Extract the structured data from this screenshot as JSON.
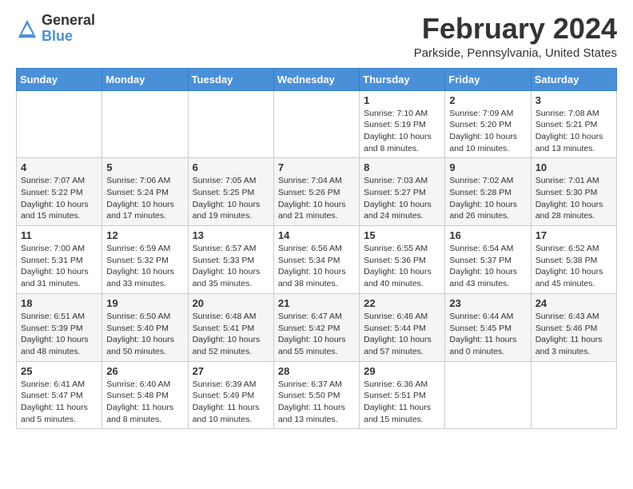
{
  "header": {
    "logo_general": "General",
    "logo_blue": "Blue",
    "month_year": "February 2024",
    "location": "Parkside, Pennsylvania, United States"
  },
  "weekdays": [
    "Sunday",
    "Monday",
    "Tuesday",
    "Wednesday",
    "Thursday",
    "Friday",
    "Saturday"
  ],
  "weeks": [
    [
      {
        "day": "",
        "info": ""
      },
      {
        "day": "",
        "info": ""
      },
      {
        "day": "",
        "info": ""
      },
      {
        "day": "",
        "info": ""
      },
      {
        "day": "1",
        "info": "Sunrise: 7:10 AM\nSunset: 5:19 PM\nDaylight: 10 hours\nand 8 minutes."
      },
      {
        "day": "2",
        "info": "Sunrise: 7:09 AM\nSunset: 5:20 PM\nDaylight: 10 hours\nand 10 minutes."
      },
      {
        "day": "3",
        "info": "Sunrise: 7:08 AM\nSunset: 5:21 PM\nDaylight: 10 hours\nand 13 minutes."
      }
    ],
    [
      {
        "day": "4",
        "info": "Sunrise: 7:07 AM\nSunset: 5:22 PM\nDaylight: 10 hours\nand 15 minutes."
      },
      {
        "day": "5",
        "info": "Sunrise: 7:06 AM\nSunset: 5:24 PM\nDaylight: 10 hours\nand 17 minutes."
      },
      {
        "day": "6",
        "info": "Sunrise: 7:05 AM\nSunset: 5:25 PM\nDaylight: 10 hours\nand 19 minutes."
      },
      {
        "day": "7",
        "info": "Sunrise: 7:04 AM\nSunset: 5:26 PM\nDaylight: 10 hours\nand 21 minutes."
      },
      {
        "day": "8",
        "info": "Sunrise: 7:03 AM\nSunset: 5:27 PM\nDaylight: 10 hours\nand 24 minutes."
      },
      {
        "day": "9",
        "info": "Sunrise: 7:02 AM\nSunset: 5:28 PM\nDaylight: 10 hours\nand 26 minutes."
      },
      {
        "day": "10",
        "info": "Sunrise: 7:01 AM\nSunset: 5:30 PM\nDaylight: 10 hours\nand 28 minutes."
      }
    ],
    [
      {
        "day": "11",
        "info": "Sunrise: 7:00 AM\nSunset: 5:31 PM\nDaylight: 10 hours\nand 31 minutes."
      },
      {
        "day": "12",
        "info": "Sunrise: 6:59 AM\nSunset: 5:32 PM\nDaylight: 10 hours\nand 33 minutes."
      },
      {
        "day": "13",
        "info": "Sunrise: 6:57 AM\nSunset: 5:33 PM\nDaylight: 10 hours\nand 35 minutes."
      },
      {
        "day": "14",
        "info": "Sunrise: 6:56 AM\nSunset: 5:34 PM\nDaylight: 10 hours\nand 38 minutes."
      },
      {
        "day": "15",
        "info": "Sunrise: 6:55 AM\nSunset: 5:36 PM\nDaylight: 10 hours\nand 40 minutes."
      },
      {
        "day": "16",
        "info": "Sunrise: 6:54 AM\nSunset: 5:37 PM\nDaylight: 10 hours\nand 43 minutes."
      },
      {
        "day": "17",
        "info": "Sunrise: 6:52 AM\nSunset: 5:38 PM\nDaylight: 10 hours\nand 45 minutes."
      }
    ],
    [
      {
        "day": "18",
        "info": "Sunrise: 6:51 AM\nSunset: 5:39 PM\nDaylight: 10 hours\nand 48 minutes."
      },
      {
        "day": "19",
        "info": "Sunrise: 6:50 AM\nSunset: 5:40 PM\nDaylight: 10 hours\nand 50 minutes."
      },
      {
        "day": "20",
        "info": "Sunrise: 6:48 AM\nSunset: 5:41 PM\nDaylight: 10 hours\nand 52 minutes."
      },
      {
        "day": "21",
        "info": "Sunrise: 6:47 AM\nSunset: 5:42 PM\nDaylight: 10 hours\nand 55 minutes."
      },
      {
        "day": "22",
        "info": "Sunrise: 6:46 AM\nSunset: 5:44 PM\nDaylight: 10 hours\nand 57 minutes."
      },
      {
        "day": "23",
        "info": "Sunrise: 6:44 AM\nSunset: 5:45 PM\nDaylight: 11 hours\nand 0 minutes."
      },
      {
        "day": "24",
        "info": "Sunrise: 6:43 AM\nSunset: 5:46 PM\nDaylight: 11 hours\nand 3 minutes."
      }
    ],
    [
      {
        "day": "25",
        "info": "Sunrise: 6:41 AM\nSunset: 5:47 PM\nDaylight: 11 hours\nand 5 minutes."
      },
      {
        "day": "26",
        "info": "Sunrise: 6:40 AM\nSunset: 5:48 PM\nDaylight: 11 hours\nand 8 minutes."
      },
      {
        "day": "27",
        "info": "Sunrise: 6:39 AM\nSunset: 5:49 PM\nDaylight: 11 hours\nand 10 minutes."
      },
      {
        "day": "28",
        "info": "Sunrise: 6:37 AM\nSunset: 5:50 PM\nDaylight: 11 hours\nand 13 minutes."
      },
      {
        "day": "29",
        "info": "Sunrise: 6:36 AM\nSunset: 5:51 PM\nDaylight: 11 hours\nand 15 minutes."
      },
      {
        "day": "",
        "info": ""
      },
      {
        "day": "",
        "info": ""
      }
    ]
  ]
}
